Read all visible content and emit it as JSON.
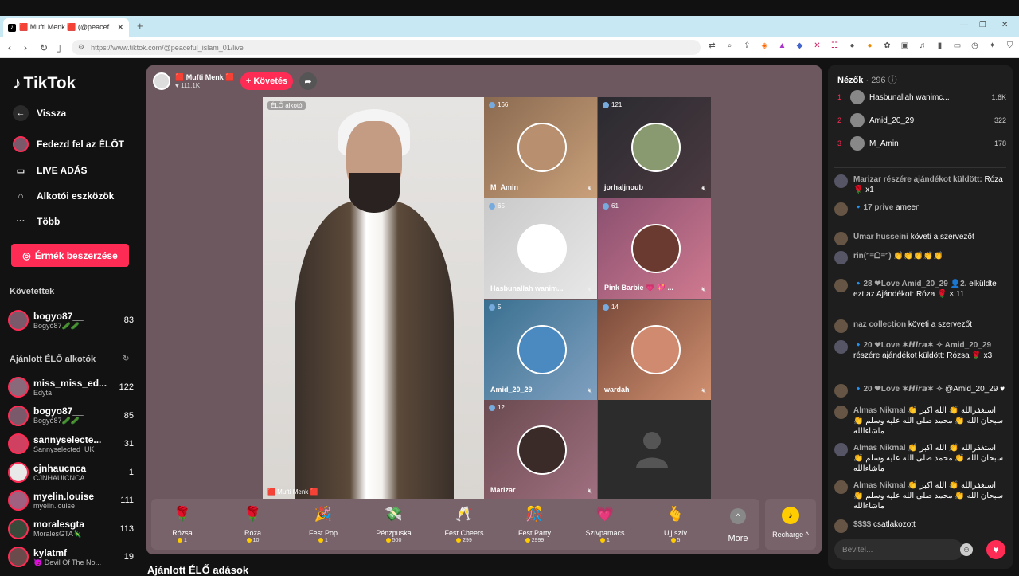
{
  "browser": {
    "tab_title": "🟥 Mufti Menk 🟥 (@peacef",
    "tab_close": "✕",
    "new_tab": "+",
    "url": "https://www.tiktok.com/@peaceful_islam_01/live"
  },
  "sidebar": {
    "logo": "TikTok",
    "nav": [
      {
        "label": "Vissza",
        "icon": "back-arrow-icon"
      },
      {
        "label": "Fedezd fel az ÉLŐT",
        "icon": "explore-live-icon"
      },
      {
        "label": "LIVE ADÁS",
        "icon": "camera-icon"
      },
      {
        "label": "Alkotói eszközök",
        "icon": "creator-tools-icon"
      },
      {
        "label": "Több",
        "icon": "more-dots-icon"
      }
    ],
    "coin_button": "Érmék beszerzése",
    "following_header": "Követettek",
    "following": [
      {
        "name": "bogyo87__",
        "sub": "Bogyó87🥒🥒",
        "count": "83"
      }
    ],
    "recommended_header": "Ajánlott ÉLŐ alkotók",
    "recommended": [
      {
        "name": "miss_miss_ed...",
        "sub": "Edyta",
        "count": "122"
      },
      {
        "name": "bogyo87__",
        "sub": "Bogyó87🥒🥒",
        "count": "85"
      },
      {
        "name": "sannyselecte...",
        "sub": "Sannyselected_UK",
        "count": "31"
      },
      {
        "name": "cjnhaucnca",
        "sub": "CJNHAUICNCA",
        "count": "1"
      },
      {
        "name": "myelin.louise",
        "sub": "myelin.louise",
        "count": "111"
      },
      {
        "name": "moralesgta",
        "sub": "MoralesGTA🦎",
        "count": "113"
      },
      {
        "name": "kylatmf",
        "sub": "😈 Devil Of The No...",
        "count": "19"
      }
    ]
  },
  "stage": {
    "host_name": "🟥 Mufti Menk 🟥",
    "host_likes": "♥ 111.1K",
    "follow_button": "+ Követés",
    "share_icon": "share-icon",
    "main_tag": "ÉLŐ alkotó",
    "main_caption": "🟥 Mufti Menk 🟥",
    "guests": [
      {
        "viewers": "166",
        "name": "M_Amin",
        "bg": "linear-gradient(135deg,#8a6a50,#c9a07a)",
        "av": "#b89070"
      },
      {
        "viewers": "121",
        "name": "jorhaljnoub",
        "bg": "linear-gradient(135deg,#2a2a30,#4a3a40)",
        "av": "#8a9a70"
      },
      {
        "viewers": "65",
        "name": "Hasbunallah wanim...",
        "bg": "linear-gradient(135deg,#c9c9c9,#e8e8e8)",
        "av": "#ffffff"
      },
      {
        "viewers": "61",
        "name": "Pink Barbie 💗 💖 ...",
        "bg": "linear-gradient(135deg,#8a5070,#d07a90)",
        "av": "#6a3a30"
      },
      {
        "viewers": "5",
        "name": "Amid_20_29",
        "bg": "linear-gradient(135deg,#3a7090,#80a0c0)",
        "av": "#4a8ac0"
      },
      {
        "viewers": "14",
        "name": "wardah",
        "bg": "linear-gradient(135deg,#7a4a3a,#d09070)",
        "av": "#d08a70"
      },
      {
        "viewers": "12",
        "name": "Marizar",
        "bg": "linear-gradient(135deg,#6a4a50,#a07080)",
        "av": "#3a2a28"
      }
    ],
    "gifts": [
      {
        "name": "Rózsa",
        "price": "1",
        "icon": "🌹"
      },
      {
        "name": "Róza",
        "price": "10",
        "icon": "🌹"
      },
      {
        "name": "Fest Pop",
        "price": "1",
        "icon": "🎉"
      },
      {
        "name": "Pénzpuska",
        "price": "500",
        "icon": "💸"
      },
      {
        "name": "Fest Cheers",
        "price": "299",
        "icon": "🥂"
      },
      {
        "name": "Fest Party",
        "price": "2999",
        "icon": "🎊"
      },
      {
        "name": "Szívpamacs",
        "price": "1",
        "icon": "💗"
      },
      {
        "name": "Ujj szív",
        "price": "5",
        "icon": "🫰"
      }
    ],
    "more_label": "More",
    "recharge_label": "Recharge ^"
  },
  "bottom_title": "Ajánlott ÉLŐ adások",
  "chat": {
    "viewers_label": "Nézők",
    "viewers_count": "· 296",
    "ranking": [
      {
        "rank": "1",
        "name": "Hasbunallah wanimc...",
        "value": "1.6K"
      },
      {
        "rank": "2",
        "name": "Amid_20_29",
        "value": "322"
      },
      {
        "rank": "3",
        "name": "M_Amin",
        "value": "178"
      }
    ],
    "messages": [
      {
        "user": "Marizar részére ajándékot küldött:",
        "text": "Róza 🌹 x1"
      },
      {
        "user": "🔹17 prive",
        "text": "ameen"
      },
      {
        "user": "Umar husseini",
        "text": "követi a szervezőt"
      },
      {
        "user": "rin(ᵔ≡ᗝ≡ᵔ)",
        "text": "👏👏👏👏👏"
      },
      {
        "user": "🔹28 ❤Love Amid_20_29 👤2.",
        "text": "elküldte ezt az Ajándékot: Róza 🌹 × 11"
      },
      {
        "user": "naz collection",
        "text": "követi a szervezőt"
      },
      {
        "user": "🔹20 ❤Love ✶𝙃𝙞𝙧𝙖✶ ✧ Amid_20_29",
        "text": "részére ajándékot küldött: Rózsa 🌹 x3"
      },
      {
        "user": "🔹20 ❤Love ✶𝙃𝙞𝙧𝙖✶ ✧",
        "text": "@Amid_20_29 ♥"
      },
      {
        "user": "Almas Nikmal",
        "text": "استغفرالله 👏 الله اکبر 👏 سبحان الله 👏 محمد صلی الله علیه وسلم 👏 ماشاءالله"
      },
      {
        "user": "Almas Nikmal",
        "text": "استغفرالله 👏 الله اکبر 👏 سبحان الله 👏 محمد صلی الله علیه وسلم 👏 ماشاءالله"
      },
      {
        "user": "Almas Nikmal",
        "text": "استغفرالله 👏 الله اکبر 👏 سبحان الله 👏 محمد صلی الله علیه وسلم 👏 ماشاءالله"
      },
      {
        "user": "$$$$",
        "text": "csatlakozott"
      }
    ],
    "input_placeholder": "Bevitel..."
  },
  "colors": {
    "accent": "#fe2c55",
    "stage": "#6e5860",
    "chat_bg": "#1e1e1e"
  }
}
